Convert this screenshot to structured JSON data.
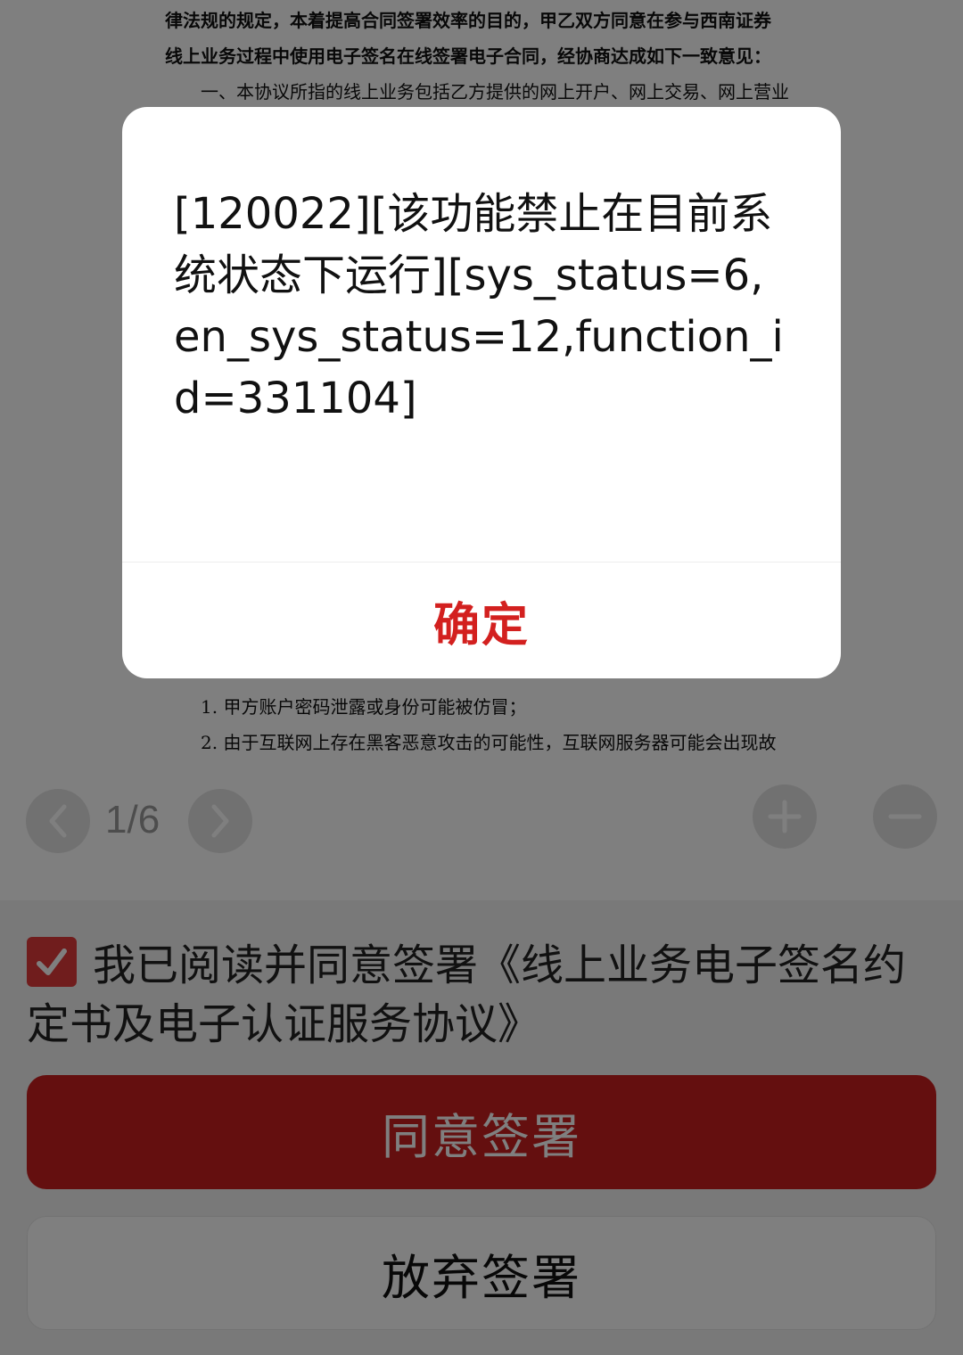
{
  "document": {
    "lines": [
      "律法规的规定，本着提高合同签署效率的目的，甲乙双方同意在参与西南证券",
      "线上业务过程中使用电子签名在线签署电子合同，经协商达成如下一致意见：",
      "一、本协议所指的线上业务包括乙方提供的网上开户、网上交易、网上营业",
      "1. 甲方账户密码泄露或身份可能被仿冒；",
      "2. 由于互联网上存在黑客恶意攻击的可能性，互联网服务器可能会出现故"
    ]
  },
  "pager": {
    "page_indicator": "1/6"
  },
  "agreement": {
    "checked": true,
    "text": "我已阅读并同意签署《线上业务电子签名约定书及电子认证服务协议》"
  },
  "buttons": {
    "agree_sign": "同意签署",
    "abandon_sign": "放弃签署"
  },
  "dialog": {
    "message": "[120022][该功能禁止在目前系统状态下运行][sys_status=6,en_sys_status=12,function_id=331104]",
    "confirm": "确定"
  },
  "colors": {
    "accent_red": "#c81f1f",
    "confirm_red": "#d3201f",
    "checkbox_red": "#e03a3a"
  }
}
